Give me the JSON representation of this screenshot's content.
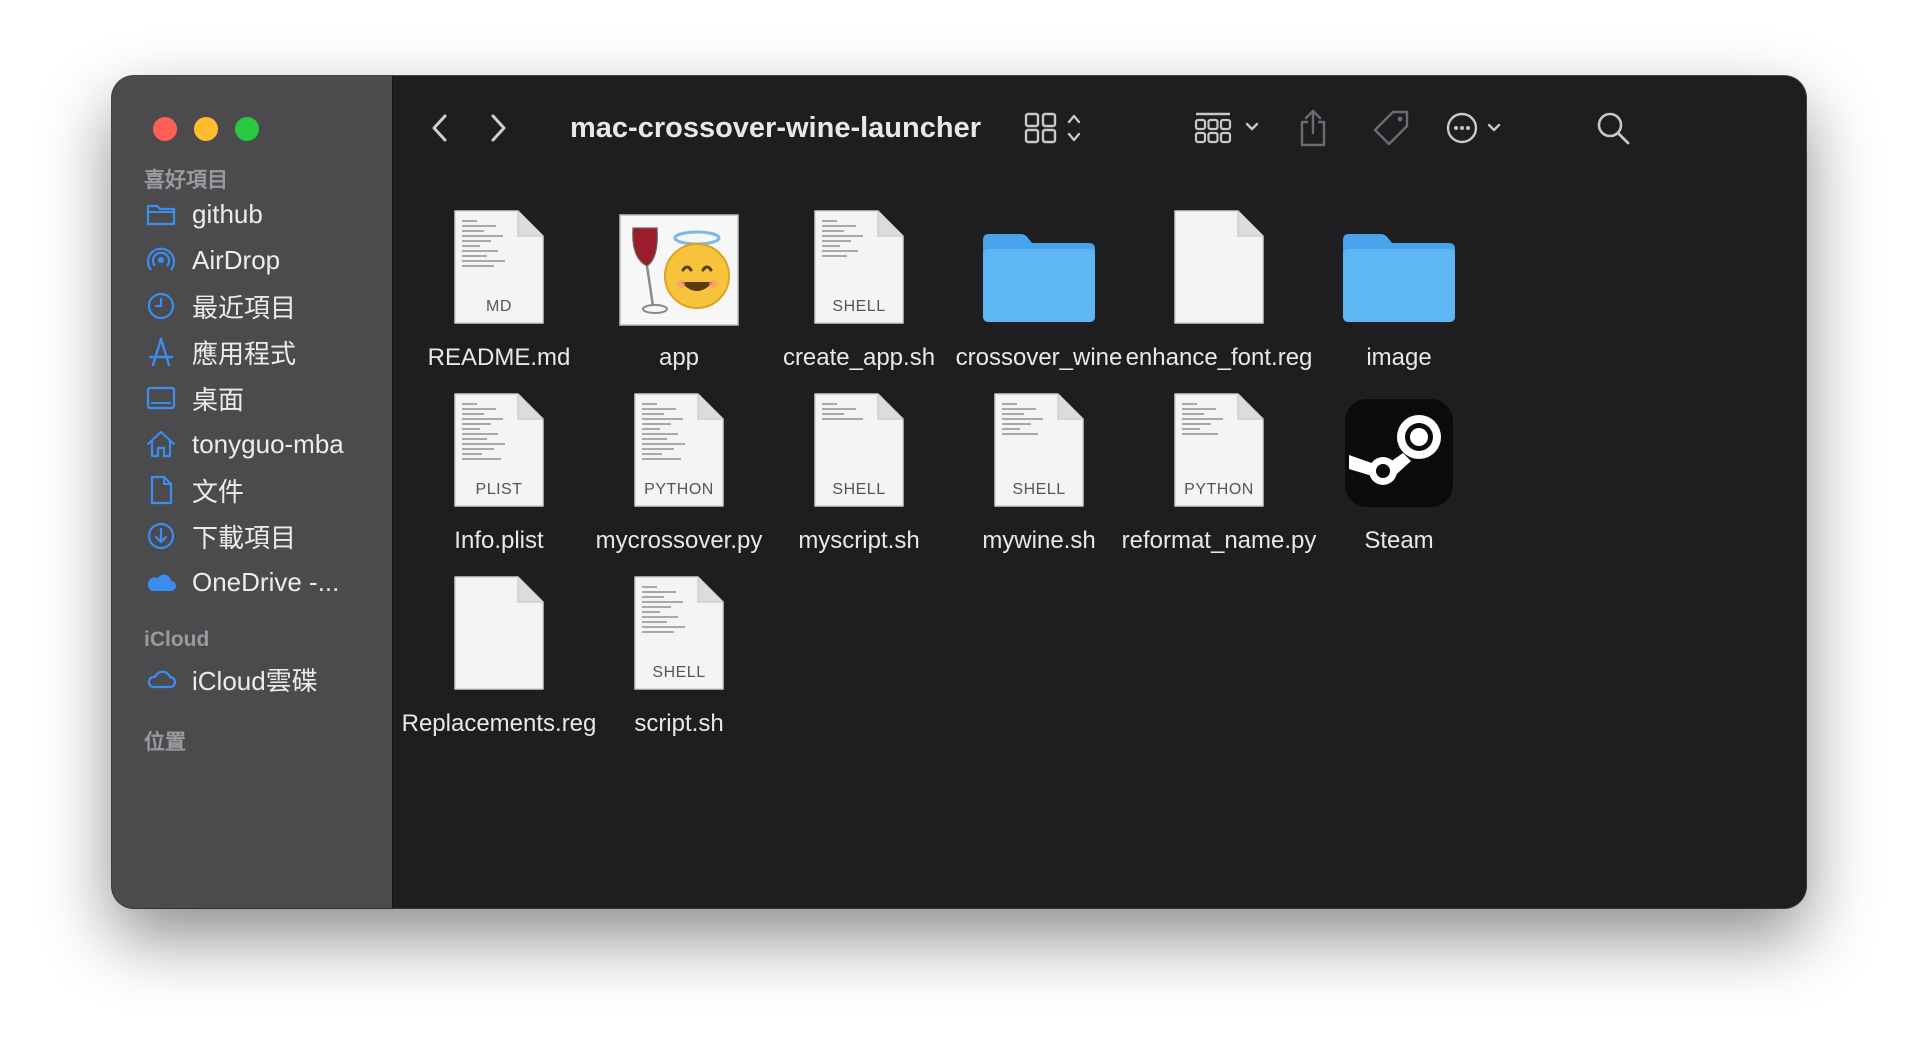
{
  "window": {
    "title": "mac-crossover-wine-launcher"
  },
  "sidebar": {
    "sections": [
      {
        "header": "喜好項目",
        "items": [
          {
            "label": "github",
            "icon": "folder-icon"
          },
          {
            "label": "AirDrop",
            "icon": "airdrop-icon"
          },
          {
            "label": "最近項目",
            "icon": "clock-icon"
          },
          {
            "label": "應用程式",
            "icon": "applications-icon"
          },
          {
            "label": "桌面",
            "icon": "desktop-icon"
          },
          {
            "label": "tonyguo-mba",
            "icon": "home-icon"
          },
          {
            "label": "文件",
            "icon": "document-icon"
          },
          {
            "label": "下載項目",
            "icon": "download-icon"
          },
          {
            "label": "OneDrive -...",
            "icon": "onedrive-cloud-icon"
          }
        ]
      },
      {
        "header": "iCloud",
        "items": [
          {
            "label": "iCloud雲碟",
            "icon": "icloud-icon"
          }
        ]
      },
      {
        "header": "位置",
        "items": []
      }
    ]
  },
  "toolbar": {
    "back_icon": "chevron-left-icon",
    "forward_icon": "chevron-right-icon",
    "view_icon": "grid-view-icon",
    "group_icon": "group-by-icon",
    "share_icon": "share-icon",
    "tag_icon": "tag-icon",
    "more_icon": "ellipsis-circle-icon",
    "search_icon": "search-icon"
  },
  "files": [
    {
      "name": "README.md",
      "type": "doc",
      "kind": "MD",
      "lines": 10
    },
    {
      "name": "app",
      "type": "app-wine",
      "kind": ""
    },
    {
      "name": "create_app.sh",
      "type": "doc",
      "kind": "SHELL",
      "lines": 8
    },
    {
      "name": "crossover_wine",
      "type": "folder",
      "kind": ""
    },
    {
      "name": "enhance_font.reg",
      "type": "doc",
      "kind": "",
      "lines": 0
    },
    {
      "name": "image",
      "type": "folder",
      "kind": ""
    },
    {
      "name": "Info.plist",
      "type": "doc",
      "kind": "PLIST",
      "lines": 12
    },
    {
      "name": "mycrossover.py",
      "type": "doc",
      "kind": "PYTHON",
      "lines": 12
    },
    {
      "name": "myscript.sh",
      "type": "doc",
      "kind": "SHELL",
      "lines": 4
    },
    {
      "name": "mywine.sh",
      "type": "doc",
      "kind": "SHELL",
      "lines": 7
    },
    {
      "name": "reformat_name.py",
      "type": "doc",
      "kind": "PYTHON",
      "lines": 7
    },
    {
      "name": "Steam",
      "type": "app-steam",
      "kind": ""
    },
    {
      "name": "Replacements.reg",
      "type": "doc",
      "kind": "",
      "lines": 0
    },
    {
      "name": "script.sh",
      "type": "doc",
      "kind": "SHELL",
      "lines": 10
    }
  ],
  "colors": {
    "sidebar_icon": "#3b8ef0",
    "folder": "#5fb6f5",
    "folder_dark": "#48a3ea"
  }
}
